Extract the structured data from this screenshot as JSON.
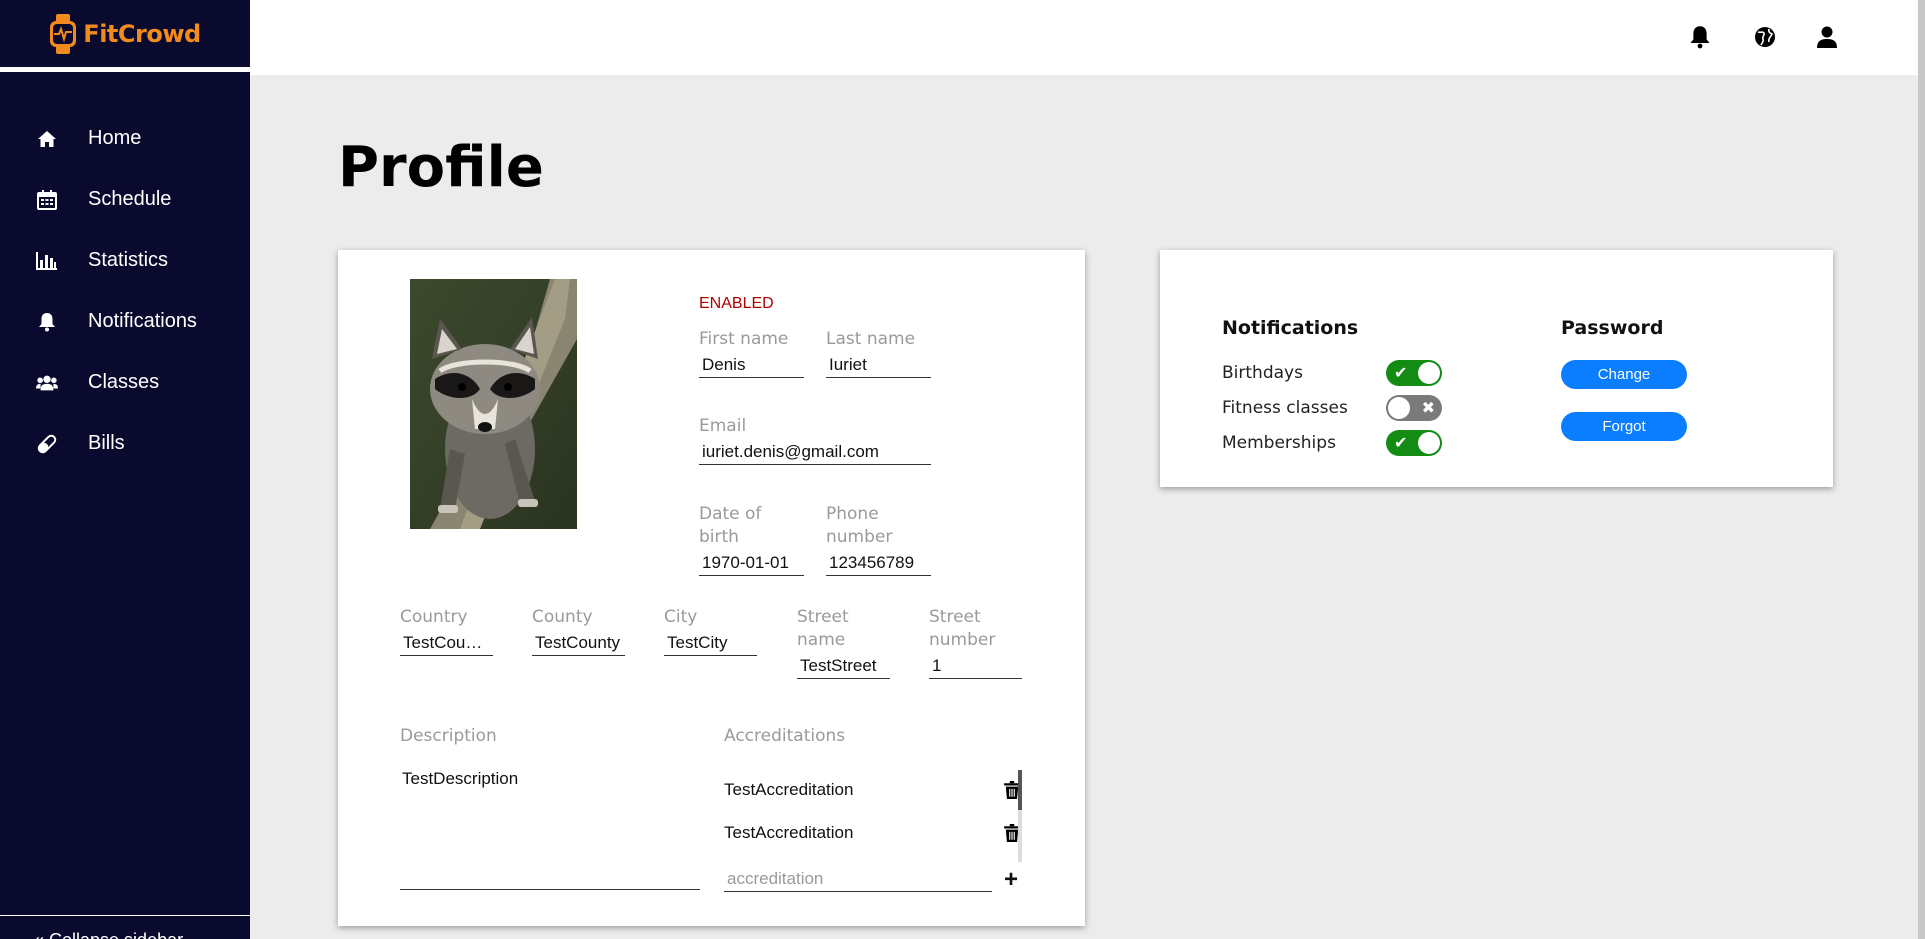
{
  "app": {
    "name": "FitCrowd",
    "brand_color": "#f28a1d"
  },
  "sidebar": {
    "items": [
      {
        "label": "Home",
        "icon": "home-icon"
      },
      {
        "label": "Schedule",
        "icon": "calendar-icon"
      },
      {
        "label": "Statistics",
        "icon": "bar-chart-icon"
      },
      {
        "label": "Notifications",
        "icon": "bell-icon"
      },
      {
        "label": "Classes",
        "icon": "users-icon"
      },
      {
        "label": "Bills",
        "icon": "pill-icon"
      }
    ],
    "collapse_label": "« Collapse sidebar"
  },
  "topbar": {
    "icons": [
      "bell-icon",
      "globe-icon",
      "user-icon"
    ]
  },
  "page": {
    "title": "Profile"
  },
  "profile": {
    "status": "ENABLED",
    "first_name": {
      "label": "First name",
      "value": "Denis"
    },
    "last_name": {
      "label": "Last name",
      "value": "Iuriet"
    },
    "email": {
      "label": "Email",
      "value": "iuriet.denis@gmail.com"
    },
    "dob": {
      "label": "Date of birth",
      "value": "1970-01-01"
    },
    "phone": {
      "label": "Phone number",
      "value": "123456789"
    },
    "country": {
      "label": "Country",
      "value": "TestCountry"
    },
    "county": {
      "label": "County",
      "value": "TestCounty"
    },
    "city": {
      "label": "City",
      "value": "TestCity"
    },
    "street_name": {
      "label": "Street name",
      "value": "TestStreet"
    },
    "street_number": {
      "label": "Street number",
      "value": "1"
    },
    "description": {
      "label": "Description",
      "value": "TestDescription"
    },
    "accreditations": {
      "label": "Accreditations",
      "items": [
        "TestAccreditation",
        "TestAccreditation"
      ],
      "placeholder": "accreditation"
    }
  },
  "settings": {
    "notifications_title": "Notifications",
    "toggles": [
      {
        "label": "Birthdays",
        "on": true
      },
      {
        "label": "Fitness classes",
        "on": false
      },
      {
        "label": "Memberships",
        "on": true
      }
    ],
    "password_title": "Password",
    "change_label": "Change",
    "forgot_label": "Forgot"
  }
}
